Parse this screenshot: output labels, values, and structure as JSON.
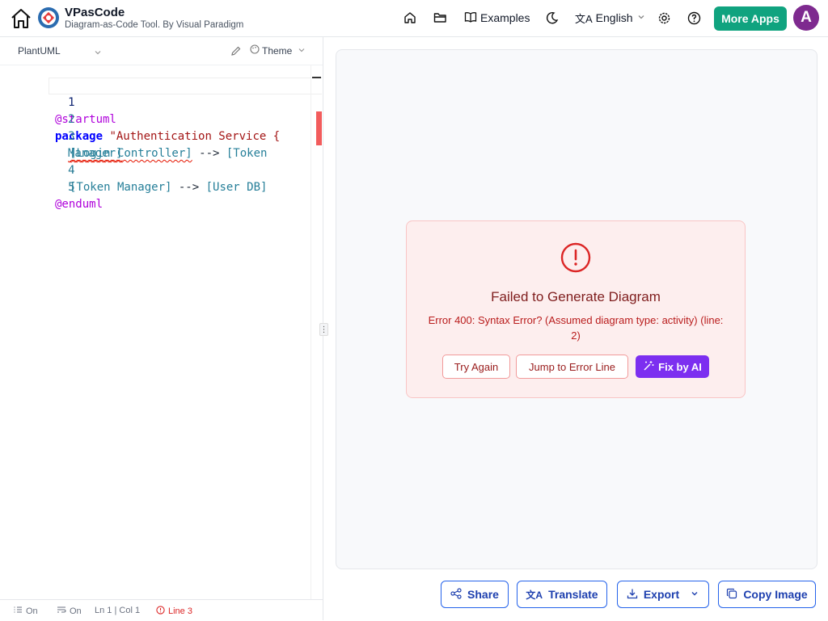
{
  "header": {
    "brand_title": "VPasCode",
    "brand_subtitle": "Diagram-as-Code Tool. By Visual Paradigm",
    "examples_label": "Examples",
    "language_label": "English",
    "more_apps_label": "More Apps",
    "avatar_initial": "A",
    "brand_color": "#10a37f",
    "avatar_color": "#7e2a8f"
  },
  "editor": {
    "language": "PlantUML",
    "theme_label": "Theme",
    "lines": [
      {
        "num": "1",
        "text": "@startuml"
      },
      {
        "num": "2",
        "keyword": "package",
        "string": " \"Authentication Service {"
      },
      {
        "num": "3",
        "part1": "[Login Controller]",
        "arrow": " --> ",
        "part2": "[Token",
        "cont": "Manager]"
      },
      {
        "num": "4",
        "part1": "[Token Manager]",
        "arrow": " --> ",
        "part2": "[User DB]"
      },
      {
        "num": "5",
        "text": "@enduml"
      }
    ]
  },
  "statusbar": {
    "line_numbers": "On",
    "wrap": "On",
    "position": "Ln 1 | Col 1",
    "error_line": "Line 3"
  },
  "error": {
    "title": "Failed to Generate Diagram",
    "message": "Error 400: Syntax Error? (Assumed diagram type: activity) (line: 2)",
    "try_again": "Try Again",
    "jump": "Jump to Error Line",
    "fix_ai": "Fix by AI",
    "accent_color": "#7c2ff0"
  },
  "actions": {
    "share": "Share",
    "translate": "Translate",
    "export": "Export",
    "copy_image": "Copy Image"
  }
}
